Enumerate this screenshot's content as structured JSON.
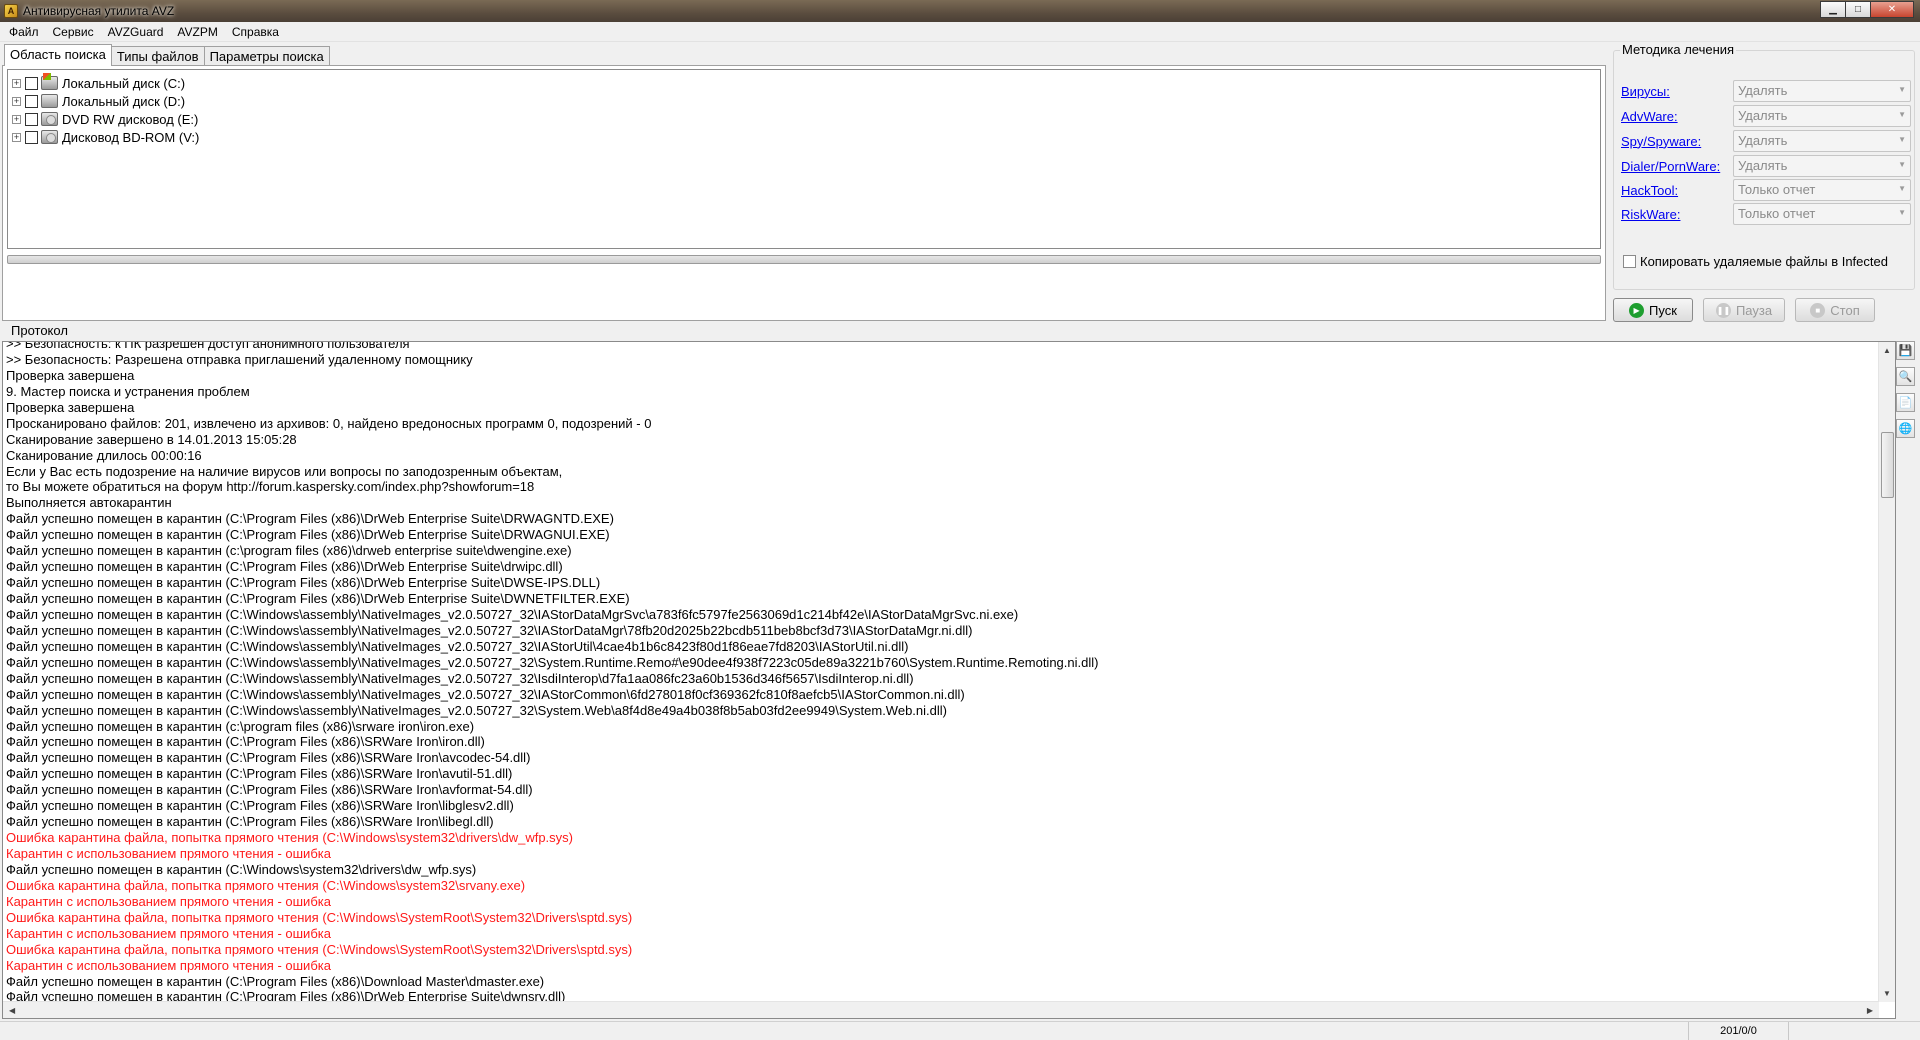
{
  "window": {
    "title": "Антивирусная утилита AVZ"
  },
  "menu": [
    "Файл",
    "Сервис",
    "AVZGuard",
    "AVZPM",
    "Справка"
  ],
  "tabs": [
    {
      "label": "Область поиска",
      "active": true
    },
    {
      "label": "Типы файлов",
      "active": false
    },
    {
      "label": "Параметры поиска",
      "active": false
    }
  ],
  "drives": [
    {
      "label": "Локальный диск (C:)",
      "icon": "system-drive-icon"
    },
    {
      "label": "Локальный диск (D:)",
      "icon": "hard-drive-icon"
    },
    {
      "label": "DVD RW дисковод (E:)",
      "icon": "dvd-drive-icon"
    },
    {
      "label": "Дисковод BD-ROM (V:)",
      "icon": "bd-drive-icon"
    }
  ],
  "method": {
    "title": "Методика лечения",
    "threats": [
      {
        "name": "Вирусы:",
        "action": "Удалять"
      },
      {
        "name": "AdvWare:",
        "action": "Удалять"
      },
      {
        "name": "Spy/Spyware:",
        "action": "Удалять"
      },
      {
        "name": "Dialer/PornWare:",
        "action": "Удалять"
      },
      {
        "name": "HackTool:",
        "action": "Только отчет"
      },
      {
        "name": "RiskWare:",
        "action": "Только отчет"
      }
    ],
    "copy_label": "Копировать удаляемые файлы в  Infected"
  },
  "actions": {
    "start": "Пуск",
    "pause": "Пауза",
    "stop": "Стоп"
  },
  "protocol": {
    "label": "Протокол",
    "lines": [
      {
        "text": ">> Безопасность: к ПК разрешен доступ анонимного пользователя",
        "error": false
      },
      {
        "text": ">> Безопасность: Разрешена отправка приглашений удаленному помощнику",
        "error": false
      },
      {
        "text": "Проверка завершена",
        "error": false
      },
      {
        "text": "9. Мастер поиска и устранения проблем",
        "error": false
      },
      {
        "text": "Проверка завершена",
        "error": false
      },
      {
        "text": "Просканировано файлов: 201, извлечено из архивов: 0, найдено вредоносных программ 0, подозрений - 0",
        "error": false
      },
      {
        "text": "Сканирование завершено в 14.01.2013 15:05:28",
        "error": false
      },
      {
        "text": "Сканирование длилось 00:00:16",
        "error": false
      },
      {
        "text": "Если у Вас есть подозрение на наличие вирусов или вопросы по заподозренным объектам,",
        "error": false
      },
      {
        "text": "то Вы можете обратиться на форум http://forum.kaspersky.com/index.php?showforum=18",
        "error": false
      },
      {
        "text": "Выполняется автокарантин",
        "error": false
      },
      {
        "text": "Файл успешно помещен в карантин (C:\\Program Files (x86)\\DrWeb Enterprise Suite\\DRWAGNTD.EXE)",
        "error": false
      },
      {
        "text": "Файл успешно помещен в карантин (C:\\Program Files (x86)\\DrWeb Enterprise Suite\\DRWAGNUI.EXE)",
        "error": false
      },
      {
        "text": "Файл успешно помещен в карантин (c:\\program files (x86)\\drweb enterprise suite\\dwengine.exe)",
        "error": false
      },
      {
        "text": "Файл успешно помещен в карантин (C:\\Program Files (x86)\\DrWeb Enterprise Suite\\drwipc.dll)",
        "error": false
      },
      {
        "text": "Файл успешно помещен в карантин (C:\\Program Files (x86)\\DrWeb Enterprise Suite\\DWSE-IPS.DLL)",
        "error": false
      },
      {
        "text": "Файл успешно помещен в карантин (C:\\Program Files (x86)\\DrWeb Enterprise Suite\\DWNETFILTER.EXE)",
        "error": false
      },
      {
        "text": "Файл успешно помещен в карантин (C:\\Windows\\assembly\\NativeImages_v2.0.50727_32\\IAStorDataMgrSvc\\a783f6fc5797fe2563069d1c214bf42e\\IAStorDataMgrSvc.ni.exe)",
        "error": false
      },
      {
        "text": "Файл успешно помещен в карантин (C:\\Windows\\assembly\\NativeImages_v2.0.50727_32\\IAStorDataMgr\\78fb20d2025b22bcdb511beb8bcf3d73\\IAStorDataMgr.ni.dll)",
        "error": false
      },
      {
        "text": "Файл успешно помещен в карантин (C:\\Windows\\assembly\\NativeImages_v2.0.50727_32\\IAStorUtil\\4cae4b1b6c8423f80d1f86eae7fd8203\\IAStorUtil.ni.dll)",
        "error": false
      },
      {
        "text": "Файл успешно помещен в карантин (C:\\Windows\\assembly\\NativeImages_v2.0.50727_32\\System.Runtime.Remo#\\e90dee4f938f7223c05de89a3221b760\\System.Runtime.Remoting.ni.dll)",
        "error": false
      },
      {
        "text": "Файл успешно помещен в карантин (C:\\Windows\\assembly\\NativeImages_v2.0.50727_32\\IsdiInterop\\d7fa1aa086fc23a60b1536d346f5657\\IsdiInterop.ni.dll)",
        "error": false
      },
      {
        "text": "Файл успешно помещен в карантин (C:\\Windows\\assembly\\NativeImages_v2.0.50727_32\\IAStorCommon\\6fd278018f0cf369362fc810f8aefcb5\\IAStorCommon.ni.dll)",
        "error": false
      },
      {
        "text": "Файл успешно помещен в карантин (C:\\Windows\\assembly\\NativeImages_v2.0.50727_32\\System.Web\\a8f4d8e49a4b038f8b5ab03fd2ee9949\\System.Web.ni.dll)",
        "error": false
      },
      {
        "text": "Файл успешно помещен в карантин (c:\\program files (x86)\\srware iron\\iron.exe)",
        "error": false
      },
      {
        "text": "Файл успешно помещен в карантин (C:\\Program Files (x86)\\SRWare Iron\\iron.dll)",
        "error": false
      },
      {
        "text": "Файл успешно помещен в карантин (C:\\Program Files (x86)\\SRWare Iron\\avcodec-54.dll)",
        "error": false
      },
      {
        "text": "Файл успешно помещен в карантин (C:\\Program Files (x86)\\SRWare Iron\\avutil-51.dll)",
        "error": false
      },
      {
        "text": "Файл успешно помещен в карантин (C:\\Program Files (x86)\\SRWare Iron\\avformat-54.dll)",
        "error": false
      },
      {
        "text": "Файл успешно помещен в карантин (C:\\Program Files (x86)\\SRWare Iron\\libglesv2.dll)",
        "error": false
      },
      {
        "text": "Файл успешно помещен в карантин (C:\\Program Files (x86)\\SRWare Iron\\libegl.dll)",
        "error": false
      },
      {
        "text": "Ошибка карантина файла, попытка прямого чтения (C:\\Windows\\system32\\drivers\\dw_wfp.sys)",
        "error": true
      },
      {
        "text": " Карантин с использованием прямого чтения - ошибка",
        "error": true
      },
      {
        "text": "Файл успешно помещен в карантин (C:\\Windows\\system32\\drivers\\dw_wfp.sys)",
        "error": false
      },
      {
        "text": "Ошибка карантина файла, попытка прямого чтения (C:\\Windows\\system32\\srvany.exe)",
        "error": true
      },
      {
        "text": " Карантин с использованием прямого чтения - ошибка",
        "error": true
      },
      {
        "text": "Ошибка карантина файла, попытка прямого чтения (C:\\Windows\\SystemRoot\\System32\\Drivers\\sptd.sys)",
        "error": true
      },
      {
        "text": " Карантин с использованием прямого чтения - ошибка",
        "error": true
      },
      {
        "text": "Ошибка карантина файла, попытка прямого чтения (C:\\Windows\\SystemRoot\\System32\\Drivers\\sptd.sys)",
        "error": true
      },
      {
        "text": " Карантин с использованием прямого чтения - ошибка",
        "error": true
      },
      {
        "text": "Файл успешно помещен в карантин (C:\\Program Files (x86)\\Download Master\\dmaster.exe)",
        "error": false
      },
      {
        "text": "Файл успешно помещен в карантин (C:\\Program Files (x86)\\DrWeb Enterprise Suite\\dwnsrv.dll)",
        "error": false
      }
    ]
  },
  "status": {
    "counter": "201/0/0"
  },
  "colors": {
    "error_text": "#ff1a1a",
    "link": "#0000ee",
    "start_icon": "#1e9e2f"
  }
}
